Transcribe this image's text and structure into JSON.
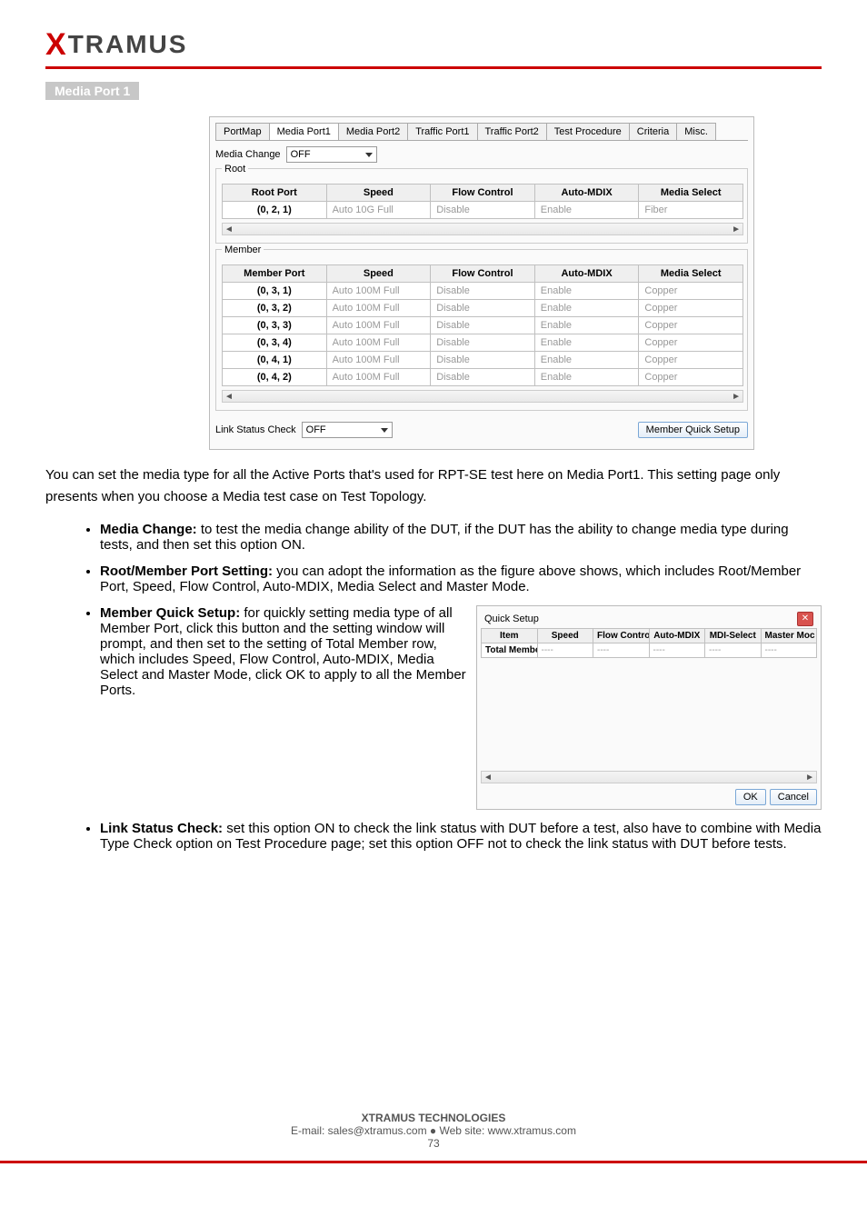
{
  "logo": {
    "text": "TRAMUS"
  },
  "section_heading": "Media Port 1",
  "fig1": {
    "tabs": [
      "PortMap",
      "Media Port1",
      "Media Port2",
      "Traffic Port1",
      "Traffic Port2",
      "Test Procedure",
      "Criteria",
      "Misc."
    ],
    "active_tab": "Media Port1",
    "media_change_label": "Media Change",
    "media_change_value": "OFF",
    "root_group": "Root",
    "member_group": "Member",
    "root_headers": [
      "Root Port",
      "Speed",
      "Flow Control",
      "Auto-MDIX",
      "Media Select"
    ],
    "root_rows": [
      {
        "port": "(0, 2, 1)",
        "speed": "Auto 10G Full",
        "flow": "Disable",
        "mdix": "Enable",
        "media": "Fiber"
      }
    ],
    "member_headers": [
      "Member Port",
      "Speed",
      "Flow Control",
      "Auto-MDIX",
      "Media Select"
    ],
    "member_rows": [
      {
        "port": "(0, 3, 1)",
        "speed": "Auto 100M Full",
        "flow": "Disable",
        "mdix": "Enable",
        "media": "Copper"
      },
      {
        "port": "(0, 3, 2)",
        "speed": "Auto 100M Full",
        "flow": "Disable",
        "mdix": "Enable",
        "media": "Copper"
      },
      {
        "port": "(0, 3, 3)",
        "speed": "Auto 100M Full",
        "flow": "Disable",
        "mdix": "Enable",
        "media": "Copper"
      },
      {
        "port": "(0, 3, 4)",
        "speed": "Auto 100M Full",
        "flow": "Disable",
        "mdix": "Enable",
        "media": "Copper"
      },
      {
        "port": "(0, 4, 1)",
        "speed": "Auto 100M Full",
        "flow": "Disable",
        "mdix": "Enable",
        "media": "Copper"
      },
      {
        "port": "(0, 4, 2)",
        "speed": "Auto 100M Full",
        "flow": "Disable",
        "mdix": "Enable",
        "media": "Copper"
      }
    ],
    "link_status_label": "Link Status Check",
    "link_status_value": "OFF",
    "member_quick_setup_btn": "Member Quick Setup"
  },
  "intro_text": "You can set the media type for all the Active Ports that's used for RPT-SE test here on Media Port1. This setting page only presents when you choose a Media test case on Test Topology.",
  "bullets": {
    "b1": {
      "label": "Media Change:",
      "text": " to test the media change ability of the DUT, if the DUT has the ability to change media type during tests, and then set this option ON."
    },
    "b2": {
      "label": "Root/Member Port Setting:",
      "text": " you can adopt the information as the figure above shows, which includes Root/Member Port, Speed, Flow Control, Auto-MDIX, Media Select and Master Mode."
    },
    "b3": {
      "label": "Member Quick Setup:",
      "text": " for quickly setting media type of all Member Port, click this button and the setting window will prompt, and then set to the setting of Total Member row, which includes Speed, Flow Control, Auto-MDIX, Media Select and Master Mode, click OK to apply to all the Member Ports."
    },
    "b4": {
      "label": "Link Status Check:",
      "text": " set this option ON to check the link status with DUT before a test, also have to combine with Media Type Check option on Test Procedure page; set this option OFF not to check the link status with DUT before tests."
    }
  },
  "fig2": {
    "title": "Quick Setup",
    "headers": [
      "Item",
      "Speed",
      "Flow Control",
      "Auto-MDIX",
      "MDI-Select",
      "Master Moc"
    ],
    "row_label": "Total Member",
    "cell_placeholder": "----",
    "ok": "OK",
    "cancel": "Cancel"
  },
  "footer": {
    "brand": "XTRAMUS TECHNOLOGIES",
    "email": "E-mail: sales@xtramus.com",
    "site": "Web site: www.xtramus.com",
    "page": "73"
  }
}
